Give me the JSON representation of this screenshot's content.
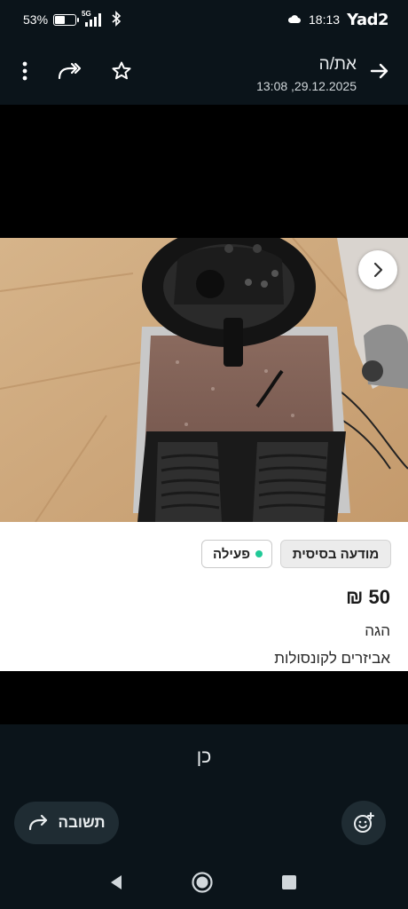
{
  "status_bar": {
    "battery_percent_label": "53%",
    "battery_level": 0.53,
    "network": "5G",
    "time": "18:13",
    "watermark": "Yad2",
    "icons": [
      "battery-icon",
      "signal-icon",
      "bluetooth-icon",
      "cloud-icon"
    ]
  },
  "header": {
    "chat_name": "את/ה",
    "timestamp": "13:08 ,29.12.2025",
    "icons": [
      "back-arrow-icon",
      "star-icon",
      "forward-icon",
      "more-vert-icon"
    ]
  },
  "listing": {
    "badges": {
      "basic": "מודעה בסיסית",
      "active": "פעילה",
      "active_dot_color": "#20c997"
    },
    "price": "50 ₪",
    "location": "הגה",
    "category": "אביזרים לקונסולות"
  },
  "caption": "כן",
  "footer": {
    "reply_label": "תשובה",
    "icons": [
      "reply-arrow-icon",
      "emoji-add-icon"
    ]
  },
  "nav": {
    "icons": [
      "back-triangle-icon",
      "home-circle-icon",
      "recents-square-icon"
    ]
  },
  "colors": {
    "background": "#0b141a",
    "surface": "#1f2c33",
    "card": "#ffffff",
    "accent_green": "#20c997"
  }
}
